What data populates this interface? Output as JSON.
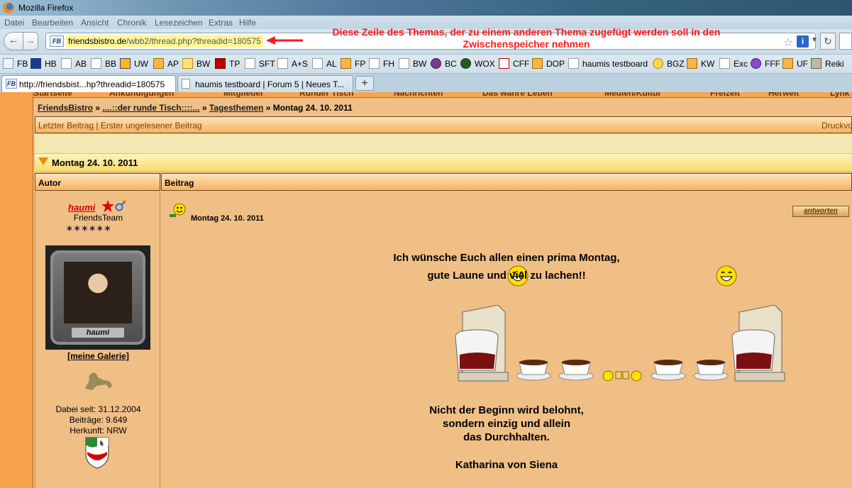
{
  "window": {
    "title": "Mozilla Firefox"
  },
  "menubar": [
    "Datei",
    "Bearbeiten",
    "Ansicht",
    "Chronik",
    "Lesezeichen",
    "Extras",
    "Hilfe"
  ],
  "urlbar": {
    "host": "friendsbistro.de",
    "path": "/wbb2/thread.php?threadid=180575"
  },
  "annotation": {
    "line1": "Diese Zeile des Themas, der zu einem anderen Thema zugefügt werden soll in den",
    "line2": "Zwischenspeicher nehmen"
  },
  "bookmarks": [
    "FB",
    "HB",
    "AB",
    "BB",
    "UW",
    "AP",
    "BW",
    "TP",
    "SFT",
    "A+S",
    "AL",
    "FP",
    "FH",
    "BW",
    "BC",
    "WOX",
    "CFF",
    "DOP",
    "haumis testboard",
    "BGZ",
    "KW",
    "Exc",
    "FFF",
    "UF",
    "Reiki"
  ],
  "tabs": [
    {
      "title": "http://friendsbist...hp?threadid=180575",
      "active": true
    },
    {
      "title": "haumis testboard | Forum 5 | Neues T...",
      "active": false
    }
  ],
  "topnav": [
    "Startseite",
    "Ankündigungen",
    "Mitglieder",
    "Runder Tisch",
    "Nachrichten",
    "Das wahre Leben",
    "Medien/Kultur",
    "Freizeit",
    "Herweit",
    "Lynk"
  ],
  "breadcrumb": {
    "site": "FriendsBistro",
    "forum": "....::der runde Tisch::::...",
    "board": "Tagesthemen",
    "thread": "Montag 24. 10. 2011",
    "sep": "»"
  },
  "options": {
    "left": "Letzter Beitrag | Erster ungelesener Beitrag",
    "right": "Druckvo"
  },
  "thread": {
    "title": "Montag 24. 10. 2011"
  },
  "columns": {
    "author": "Autor",
    "post": "Beitrag"
  },
  "author": {
    "name": "haumi",
    "title": "FriendsTeam",
    "rank_stars": 6,
    "avatar_signature": "haumi",
    "gallery": "[meine Galerie]",
    "stats": {
      "joined": "Dabei seit: 31.12.2004",
      "posts": "Beiträge: 9.649",
      "origin": "Herkunft: NRW"
    }
  },
  "post": {
    "title": "Montag 24. 10. 2011",
    "reply": "antworten",
    "greeting": "Ich wünsche Euch allen einen prima Montag,",
    "greeting2": "gute Laune und viel zu lachen!!",
    "quote1": "Nicht der Beginn wird belohnt,",
    "quote2": "sondern einzig und allein",
    "quote3": "das Durchhalten.",
    "quote_author": "Katharina von Siena"
  },
  "colors": {
    "accent": "#f7a14a",
    "annotation": "#ff1a1a",
    "link_red": "#d40000",
    "url_highlight": "#fff79a"
  }
}
